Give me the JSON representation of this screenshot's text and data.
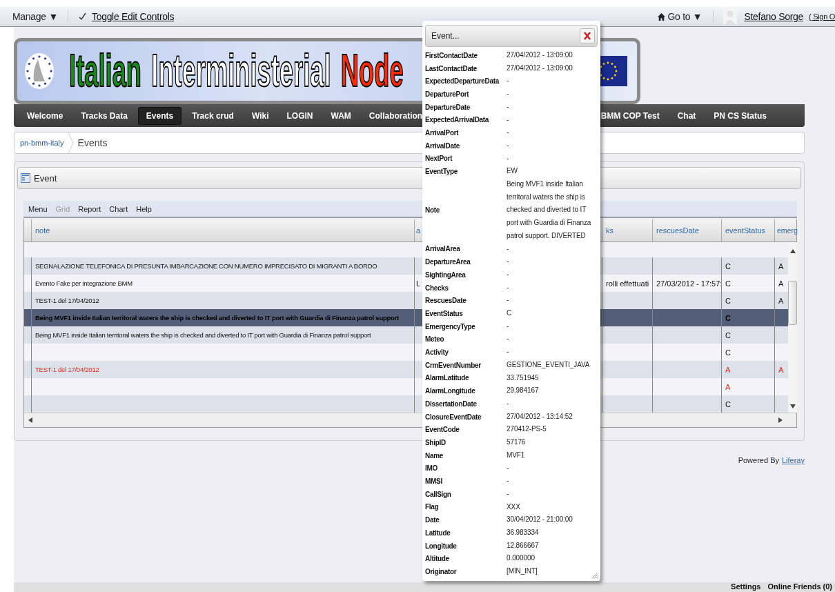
{
  "dock": {
    "manage": "Manage ▼",
    "toggle": {
      "label": "Toggle Edit Controls",
      "checked": true
    },
    "goto": "Go to ▼",
    "user": "Stefano Sorge",
    "signout": "( Sign O"
  },
  "banner": {
    "title_words": [
      {
        "text": "Italian",
        "color": "#1a8a1a"
      },
      {
        "text": "Interministerial",
        "color": "#ffffff"
      },
      {
        "text": "Node",
        "color": "#ff2a00"
      }
    ]
  },
  "nav": {
    "items_left": [
      {
        "label": "Welcome",
        "selected": false
      },
      {
        "label": "Tracks Data",
        "selected": false
      },
      {
        "label": "Events",
        "selected": true
      },
      {
        "label": "Track crud",
        "selected": false
      },
      {
        "label": "Wiki",
        "selected": false
      },
      {
        "label": "LOGIN",
        "selected": false
      },
      {
        "label": "WAM",
        "selected": false
      },
      {
        "label": "Collaboration",
        "selected": false
      }
    ],
    "items_right": [
      {
        "label": "BMM COP Test",
        "selected": false
      },
      {
        "label": "Chat",
        "selected": false
      },
      {
        "label": "PN CS Status",
        "selected": false
      }
    ]
  },
  "breadcrumb": {
    "parent": "pn-bmm-italy",
    "current": "Events"
  },
  "portlet": {
    "title": "Event",
    "toolbar": [
      {
        "label": "Menu",
        "disabled": false
      },
      {
        "label": "Grid",
        "disabled": true
      },
      {
        "label": "Report",
        "disabled": false
      },
      {
        "label": "Chart",
        "disabled": false
      },
      {
        "label": "Help",
        "disabled": false
      }
    ],
    "table": {
      "columns": [
        "note",
        "a",
        "ks",
        "rescuesDate",
        "eventStatus",
        "emerg"
      ],
      "rows": [
        {
          "cells": [
            "SEGNALAZIONE TELEFONICA DI PRESUNTA IMBARCAZIONE CON NUMERO IMPRECISATO DI MIGRANTI A BORDO",
            null,
            null,
            null,
            "C",
            "A"
          ],
          "selected": false,
          "alert": false
        },
        {
          "cells": [
            "Evento Fake per integrazione BMM",
            "L",
            "rolli effettuati",
            "27/03/2012 - 17:57:",
            "C",
            "A"
          ],
          "selected": false,
          "alert": false
        },
        {
          "cells": [
            "TEST-1 del 17/04/2012",
            null,
            null,
            null,
            "C",
            "A"
          ],
          "selected": false,
          "alert": false
        },
        {
          "cells": [
            "Being MVF1 inside Italian territoral waters the ship is checked and diverted to IT port with Guardia di Finanza patrol support",
            null,
            null,
            null,
            "C",
            null
          ],
          "selected": true,
          "alert": false
        },
        {
          "cells": [
            "Being MVF1 inside Italian territoral waters the ship is checked and diverted to IT port with Guardia di Finanza patrol support",
            null,
            null,
            null,
            "C",
            null
          ],
          "selected": false,
          "alert": false
        },
        {
          "cells": [
            null,
            null,
            null,
            null,
            "C",
            null
          ],
          "selected": false,
          "alert": false
        },
        {
          "cells": [
            "TEST-1 del 17/04/2012",
            null,
            null,
            null,
            "A",
            "A"
          ],
          "selected": false,
          "alert": true
        },
        {
          "cells": [
            null,
            null,
            null,
            null,
            "A",
            null
          ],
          "selected": false,
          "alert": true
        },
        {
          "cells": [
            null,
            null,
            null,
            null,
            "C",
            null
          ],
          "selected": false,
          "alert": false
        }
      ]
    }
  },
  "powered": {
    "text": "Powered By",
    "link": "Liferay"
  },
  "bottom_bar": [
    "Settings",
    "Online Friends (0)"
  ],
  "dialog": {
    "title": "Event...",
    "fields": [
      {
        "label": "FirstContactDate",
        "value": "27/04/2012 - 13:09:00"
      },
      {
        "label": "LastContactDate",
        "value": "27/04/2012 - 13:09:00"
      },
      {
        "label": "ExpectedDepartureData",
        "value": "-"
      },
      {
        "label": "DeparturePort",
        "value": "-"
      },
      {
        "label": "DepartureDate",
        "value": "-"
      },
      {
        "label": "ExpectedArrivalData",
        "value": "-"
      },
      {
        "label": "ArrivalPort",
        "value": "-"
      },
      {
        "label": "ArrivalDate",
        "value": "-"
      },
      {
        "label": "NextPort",
        "value": "-"
      },
      {
        "label": "EventType",
        "value": "EW"
      },
      {
        "label": "Note",
        "value": "Being MVF1 inside Italian territoral waters the ship is checked and diverted to IT port with Guardia di Finanza patrol support. DIVERTED"
      },
      {
        "label": "ArrivalArea",
        "value": "-"
      },
      {
        "label": "DepartureArea",
        "value": "-"
      },
      {
        "label": "SightingArea",
        "value": "-"
      },
      {
        "label": "Checks",
        "value": "-"
      },
      {
        "label": "RescuesDate",
        "value": "-"
      },
      {
        "label": "EventStatus",
        "value": "C"
      },
      {
        "label": "EmergencyType",
        "value": "-"
      },
      {
        "label": "Meteo",
        "value": "-"
      },
      {
        "label": "Activity",
        "value": "-"
      },
      {
        "label": "CrmEventNumber",
        "value": "GESTIONE_EVENTI_JAVA"
      },
      {
        "label": "AlarmLatitude",
        "value": "33.751945"
      },
      {
        "label": "AlarmLongitude",
        "value": "29.984167"
      },
      {
        "label": "DissertationDate",
        "value": "-"
      },
      {
        "label": "ClosureEventDate",
        "value": "27/04/2012 - 13:14:52"
      },
      {
        "label": "EventCode",
        "value": "270412-PS-5"
      },
      {
        "label": "ShipID",
        "value": "57176"
      },
      {
        "label": "Name",
        "value": "MVF1"
      },
      {
        "label": "IMO",
        "value": "-"
      },
      {
        "label": "MMSI",
        "value": "-"
      },
      {
        "label": "CallSign",
        "value": "-"
      },
      {
        "label": "Flag",
        "value": "XXX"
      },
      {
        "label": "Date",
        "value": "30/04/2012 - 21:00:00"
      },
      {
        "label": "Latitude",
        "value": "36.983334"
      },
      {
        "label": "Longitude",
        "value": "12.866667"
      },
      {
        "label": "Altitude",
        "value": "0.000000"
      },
      {
        "label": "Originator",
        "value": "[MIN_INT]"
      }
    ]
  }
}
